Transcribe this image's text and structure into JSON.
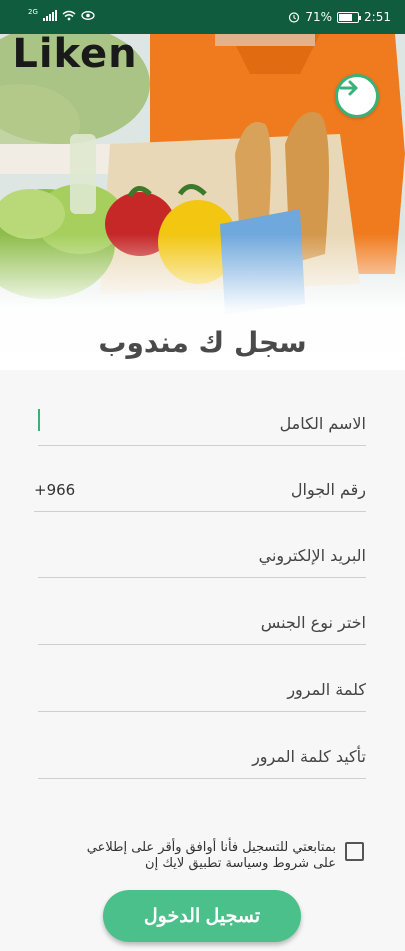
{
  "status_bar": {
    "network_label": "2G",
    "battery_percent": "71%",
    "battery_level": 0.71,
    "time": "2:51",
    "icons": [
      "signal-icon",
      "wifi-icon",
      "eye-icon",
      "alarm-icon",
      "battery-icon"
    ]
  },
  "header": {
    "logo_text": "Liken",
    "title": "سجل ك مندوب",
    "forward_icon": "arrow-right-icon"
  },
  "form": {
    "fields": [
      {
        "label": "الاسم الكامل",
        "value": "",
        "focused": true
      },
      {
        "label": "رقم الجوال",
        "prefix": "+966",
        "value": ""
      },
      {
        "label": "البريد الإلكتروني",
        "value": ""
      },
      {
        "label": "اختر نوع الجنس",
        "value": ""
      },
      {
        "label": "كلمة المرور",
        "value": ""
      },
      {
        "label": "تأكيد كلمة المرور",
        "value": ""
      }
    ],
    "terms_line1": "بمتابعتي للتسجيل فأنا أوافق وأقر على إطلاعي",
    "terms_line2": "على شروط وسياسة تطبيق لايك إن",
    "terms_checked": false,
    "submit_label": "تسجيل الدخول"
  },
  "colors": {
    "status_bar": "#0f5c3f",
    "accent": "#4cc08a",
    "title_text": "#4a4a4a"
  }
}
